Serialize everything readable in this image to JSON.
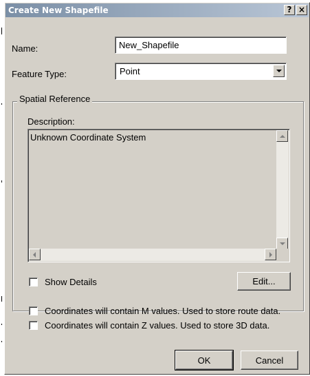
{
  "dialog": {
    "title": "Create New Shapefile",
    "help_glyph": "?",
    "close_glyph": "×"
  },
  "name": {
    "label": "Name:",
    "value": "New_Shapefile"
  },
  "feature_type": {
    "label": "Feature Type:",
    "selected": "Point"
  },
  "spatial_reference": {
    "group_title": "Spatial Reference",
    "description_label": "Description:",
    "description_text": "Unknown Coordinate System",
    "show_details_label": "Show Details",
    "show_details_checked": false,
    "edit_label": "Edit..."
  },
  "options": {
    "m_values_label": "Coordinates will contain M values. Used to store route data.",
    "m_values_checked": false,
    "z_values_label": "Coordinates will contain Z values. Used to store 3D data.",
    "z_values_checked": false
  },
  "buttons": {
    "ok_label": "OK",
    "cancel_label": "Cancel"
  },
  "colors": {
    "face": "#d4d0c8",
    "title_start": "#7b8fa6",
    "title_end": "#b9c6d6"
  }
}
